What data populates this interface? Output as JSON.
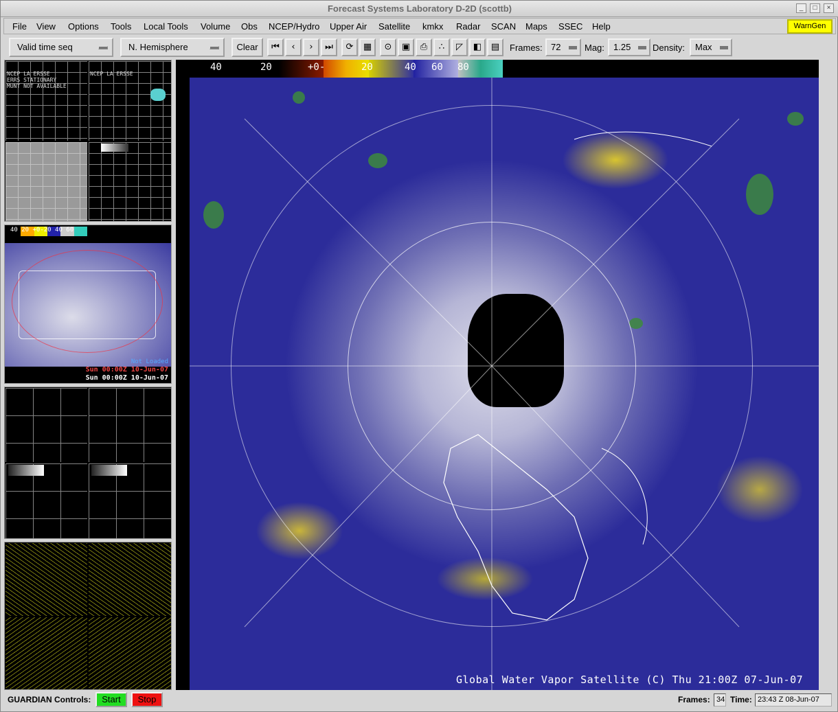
{
  "window": {
    "title": "Forecast Systems Laboratory D-2D (scottb)"
  },
  "menu": {
    "items": [
      "File",
      "View",
      "Options",
      "Tools",
      "Local Tools",
      "Volume",
      "Obs",
      "NCEP/Hydro",
      "Upper Air",
      "Satellite",
      "kmkx",
      "Radar",
      "SCAN",
      "Maps",
      "SSEC",
      "Help"
    ],
    "warngen": "WarnGen"
  },
  "toolbar": {
    "time_mode": "Valid time seq",
    "projection": "N. Hemisphere",
    "clear": "Clear",
    "frames_label": "Frames:",
    "frames_value": "72",
    "mag_label": "Mag:",
    "mag_value": "1.25",
    "density_label": "Density:",
    "density_value": "Max"
  },
  "left_panels": {
    "panel1_text": [
      "NCEP LA ERSSE",
      "ERRS STATIONARY",
      "MUNT NOT AVAILABLE",
      "NCEP LA ERSSE"
    ],
    "panel3_colorbar": "40 20 +0-20 40 60",
    "panel3_times": [
      "Sun 00:00Z 10-Jun-07",
      "Sun 00:00Z 10-Jun-07"
    ],
    "panel3_extra": "Not Loaded"
  },
  "main": {
    "colorbar_labels": [
      "40",
      "20",
      "+0-",
      "20",
      "40",
      "60",
      "80"
    ],
    "caption": "Global Water Vapor Satellite (C)  Thu 21:00Z 07-Jun-07",
    "colors": {
      "moist": "#2a2a96",
      "dry": "#d8c430",
      "clouds": "#dcdce9",
      "precip": "#3d8a3d"
    }
  },
  "status": {
    "guardian_label": "GUARDIAN Controls:",
    "start": "Start",
    "stop": "Stop",
    "frames_label": "Frames:",
    "frames_value": "34",
    "time_label": "Time:",
    "time_value": "23:43 Z 08-Jun-07"
  }
}
